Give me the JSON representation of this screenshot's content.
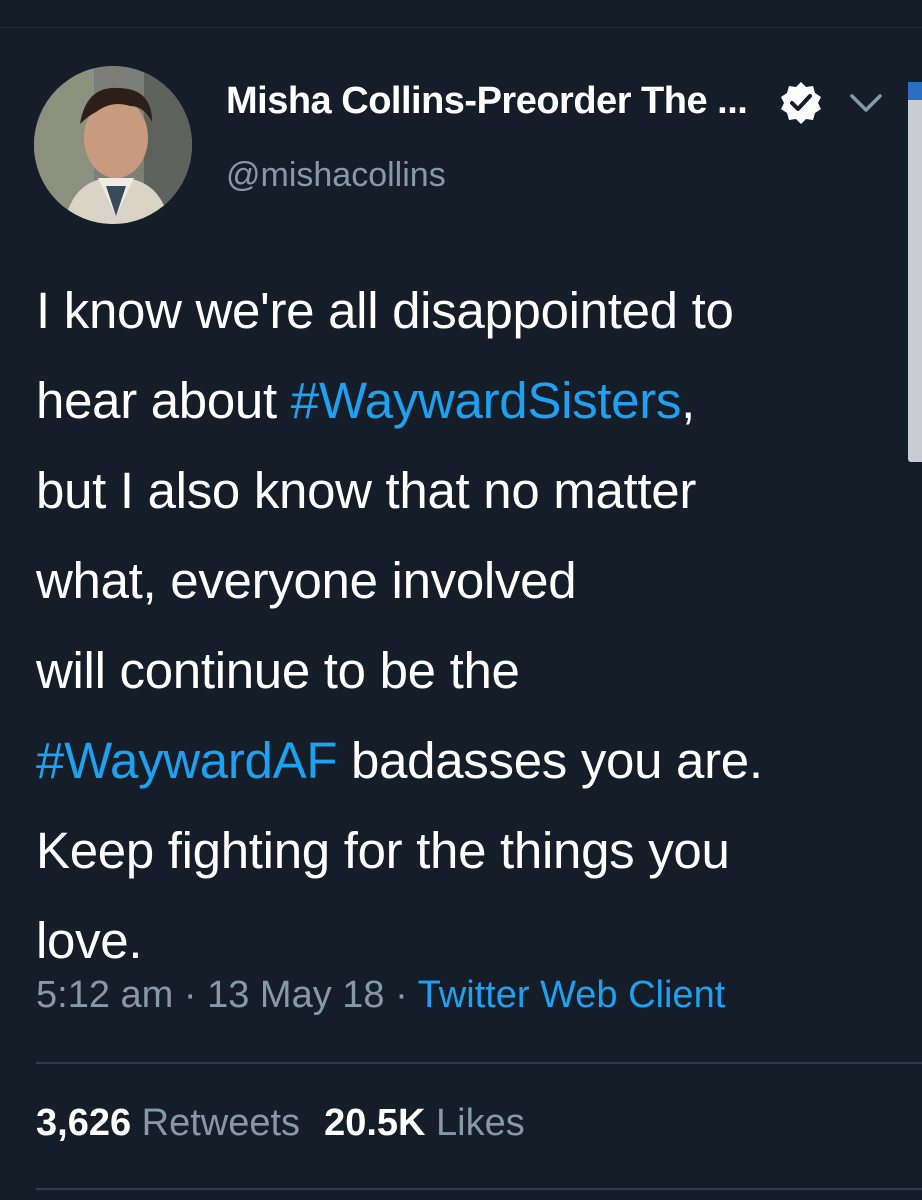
{
  "tweet": {
    "display_name": "Misha Collins-Preorder The ...",
    "handle": "@mishacollins",
    "text_lines": [
      [
        {
          "t": "I know we're all disappointed to",
          "tag": false
        }
      ],
      [
        {
          "t": "hear about ",
          "tag": false
        },
        {
          "t": "#WaywardSisters",
          "tag": true
        },
        {
          "t": ",",
          "tag": false
        }
      ],
      [
        {
          "t": "but I also know that no matter",
          "tag": false
        }
      ],
      [
        {
          "t": "what, everyone involved",
          "tag": false
        }
      ],
      [
        {
          "t": "will continue to be the",
          "tag": false
        }
      ],
      [
        {
          "t": "#WaywardAF",
          "tag": true
        },
        {
          "t": " badasses you are.",
          "tag": false
        }
      ],
      [
        {
          "t": "Keep fighting for the things you",
          "tag": false
        }
      ],
      [
        {
          "t": "love.",
          "tag": false
        }
      ]
    ],
    "time": "5:12 am",
    "date": "13 May 18",
    "separator": "·",
    "client": "Twitter Web Client",
    "retweets_count": "3,626",
    "retweets_label": "Retweets",
    "likes_count": "20.5K",
    "likes_label": "Likes"
  },
  "icons": {
    "verified": "verified-badge-icon",
    "menu": "chevron-down-icon",
    "avatar": "profile-avatar"
  },
  "colors": {
    "background": "#151e28",
    "text": "#ffffff",
    "secondary": "#8899a6",
    "link": "#1da1f2"
  }
}
